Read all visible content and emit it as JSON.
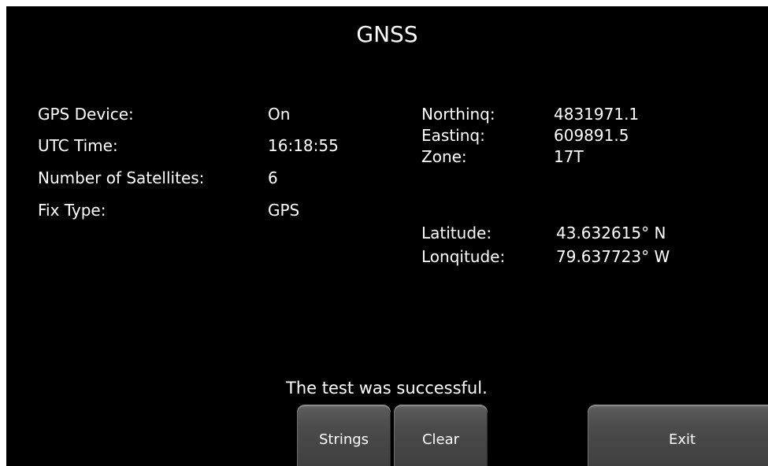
{
  "header": {
    "title": "GNSS"
  },
  "status": {
    "gps_device_label": "GPS Device:",
    "gps_device_value": "On",
    "utc_time_label": "UTC Time:",
    "utc_time_value": "16:18:55",
    "satellites_label": "Number of Satellites:",
    "satellites_value": "6",
    "fix_type_label": "Fix Type:",
    "fix_type_value": "GPS"
  },
  "utm": {
    "northing_label": "Northinq:",
    "northing_value": "4831971.1",
    "easting_label": "Eastinq:",
    "easting_value": "609891.5",
    "zone_label": "Zone:",
    "zone_value": "17T"
  },
  "geo": {
    "latitude_label": "Latitude:",
    "latitude_value": "43.632615° N",
    "longitude_label": "Lonqitude:",
    "longitude_value": "79.637723° W"
  },
  "message": "The test was successful.",
  "buttons": {
    "strings_label": "Strings",
    "clear_label": "Clear",
    "exit_label": "Exit"
  },
  "colors": {
    "background": "#000000",
    "text": "#ffffff",
    "button": "#4a4a4a"
  }
}
